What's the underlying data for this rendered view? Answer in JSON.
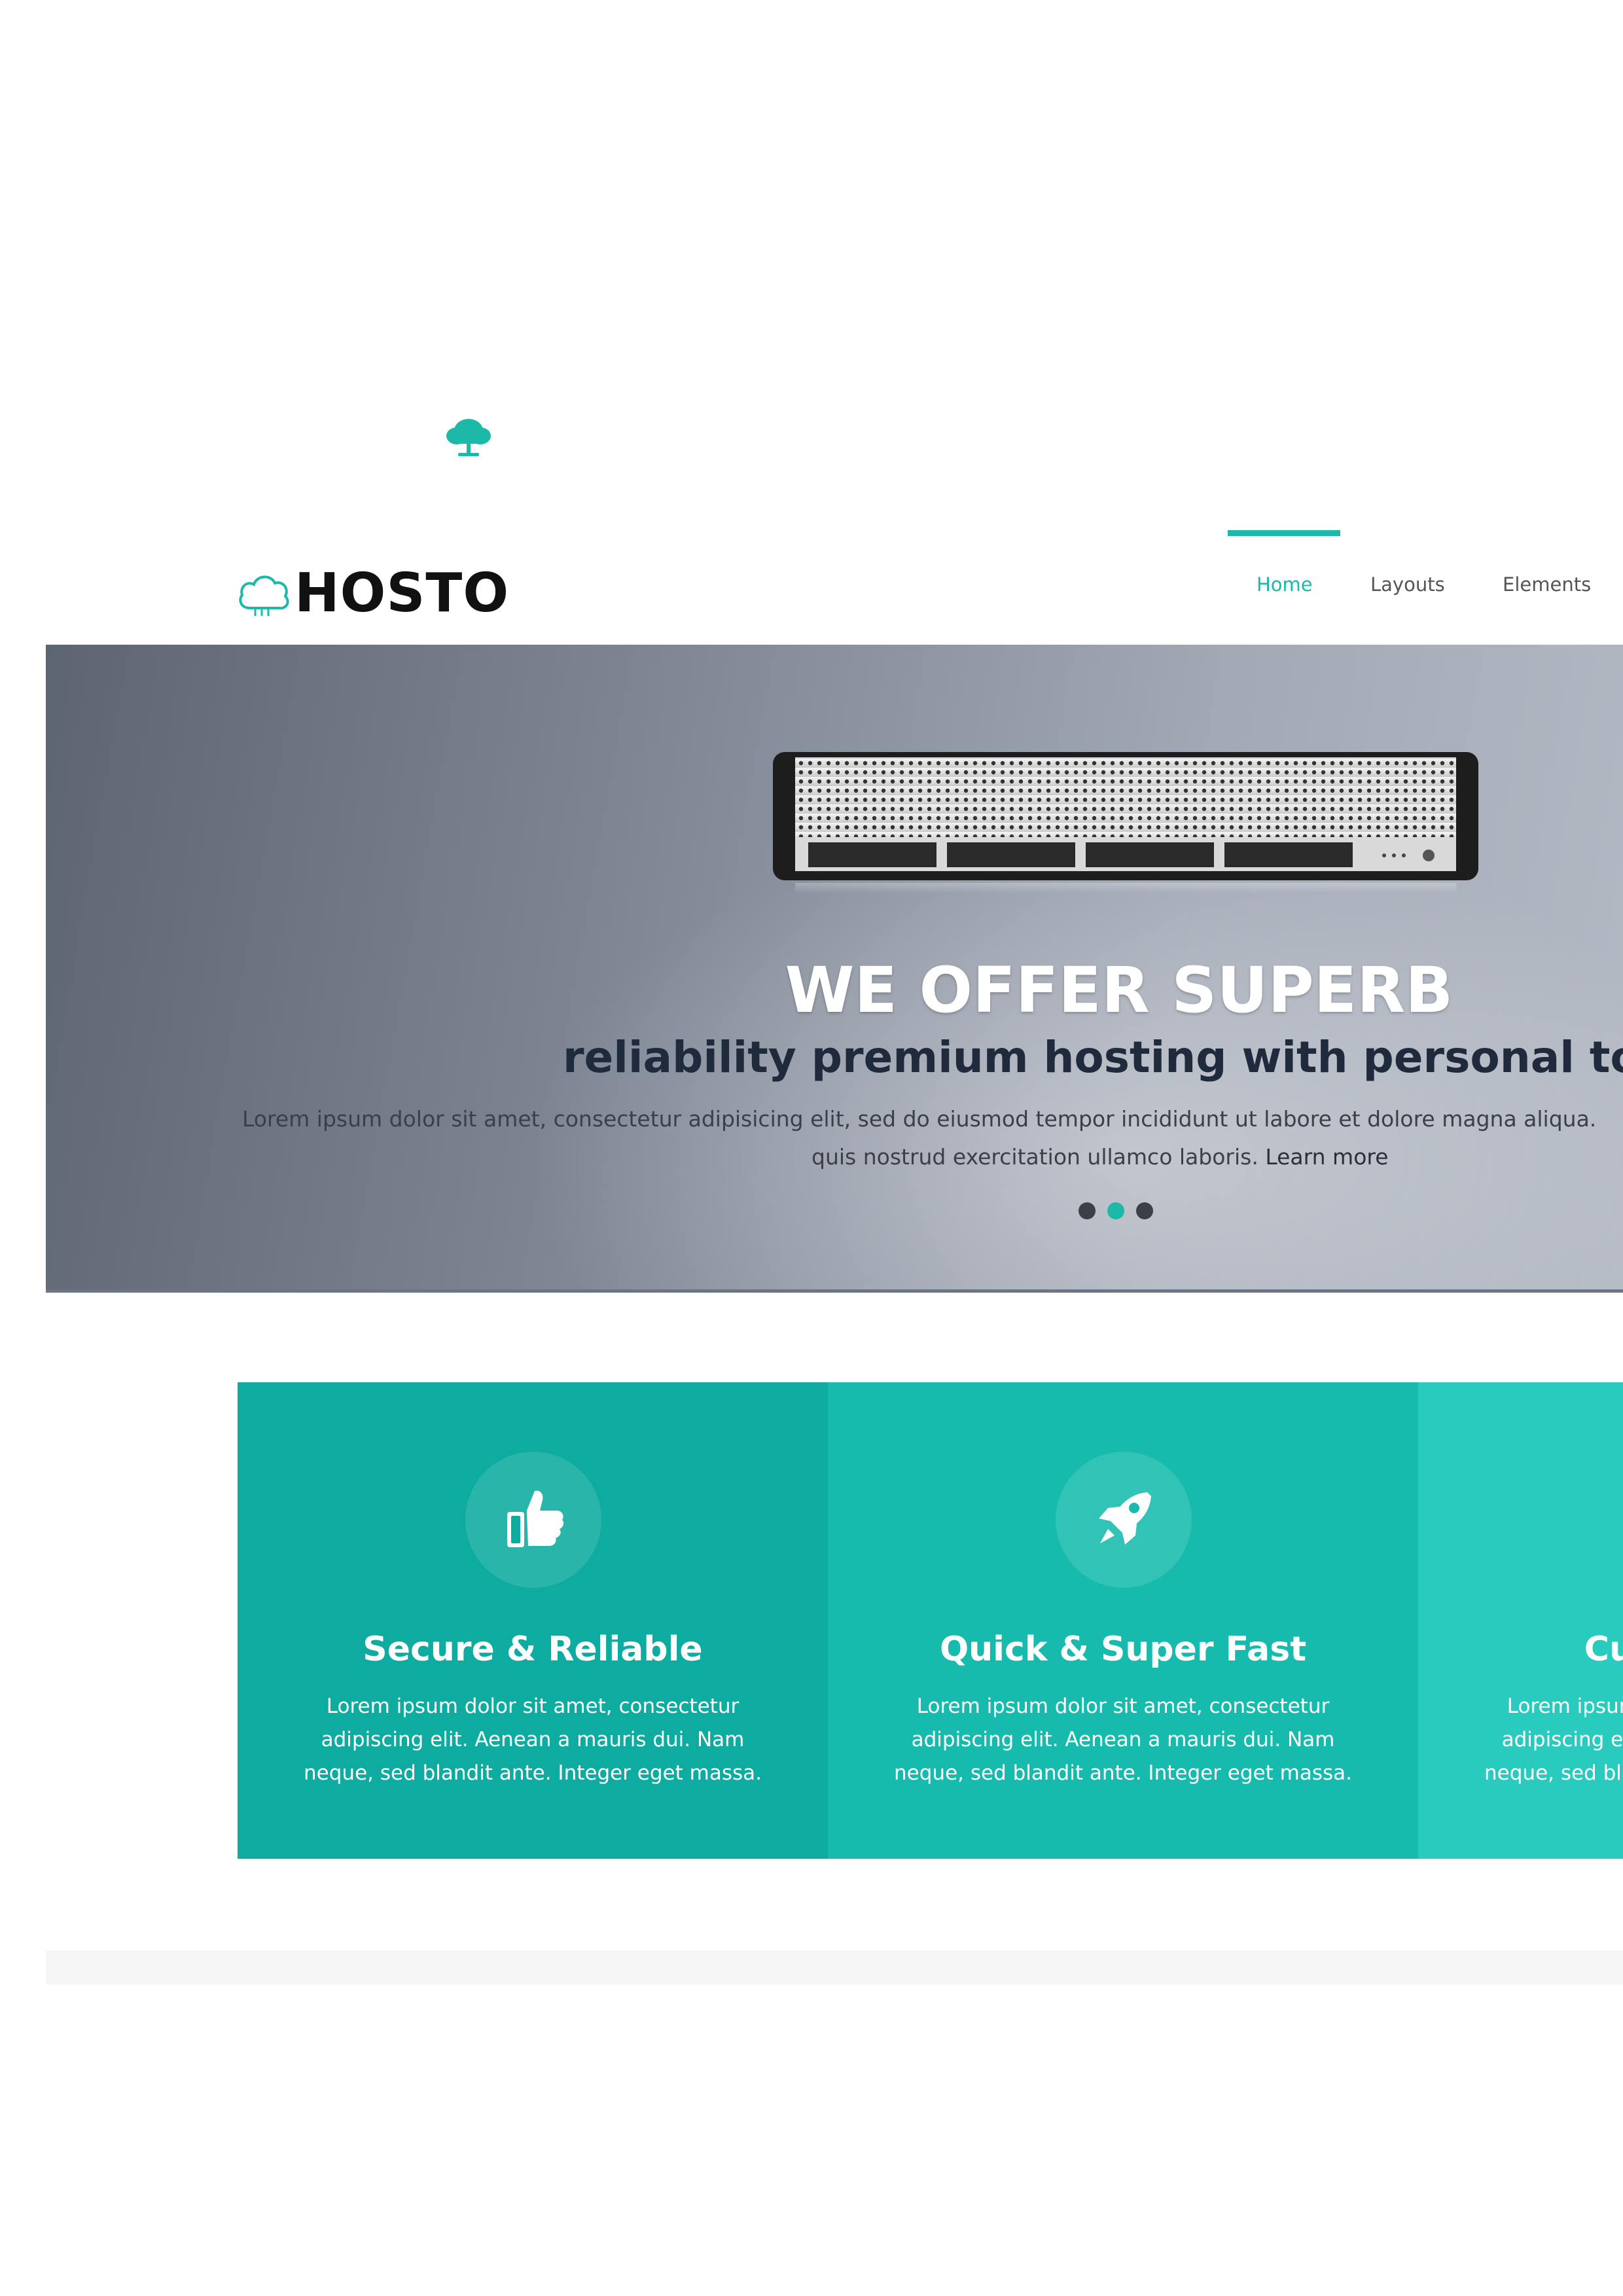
{
  "brand": {
    "logo_text": "HOSTO",
    "accent_color": "#1cb8a8",
    "icon": "cloud-icon"
  },
  "nav": {
    "items": [
      {
        "label": "Home",
        "active": true
      },
      {
        "label": "Layouts",
        "active": false
      },
      {
        "label": "Elements",
        "active": false
      }
    ]
  },
  "hero": {
    "title": "WE OFFER SUPERB",
    "subtitle": "reliability premium hosting with personal touch",
    "body_line1": "Lorem ipsum dolor sit amet, consectetur adipisicing elit, sed do eiusmod tempor incididunt ut labore et dolore magna aliqua.",
    "body_line2": "quis nostrud exercitation ullamco laboris.",
    "learn_more": "Learn more",
    "slides": 3,
    "active_slide": 2,
    "image": "server-rack"
  },
  "features": [
    {
      "icon": "thumbs-up-icon",
      "title": "Secure & Reliable",
      "lines": [
        "Lorem ipsum dolor sit amet, consectetur",
        "adipiscing elit. Aenean a mauris dui. Nam",
        "neque, sed blandit ante. Integer eget massa."
      ],
      "color": "#0daba0"
    },
    {
      "icon": "rocket-icon",
      "title": "Quick & Super Fast",
      "lines": [
        "Lorem ipsum dolor sit amet, consectetur",
        "adipiscing elit. Aenean a mauris dui. Nam",
        "neque, sed blandit ante. Integer eget massa."
      ],
      "color": "#16bbae"
    },
    {
      "icon": "settings-icon",
      "title": "Customizable",
      "lines": [
        "Lorem ipsum dolor sit amet, consectetur",
        "adipiscing elit. Aenean a mauris dui. Nam",
        "neque, sed blandit ante. Integer eget massa."
      ],
      "color": "#2acbbf"
    }
  ]
}
